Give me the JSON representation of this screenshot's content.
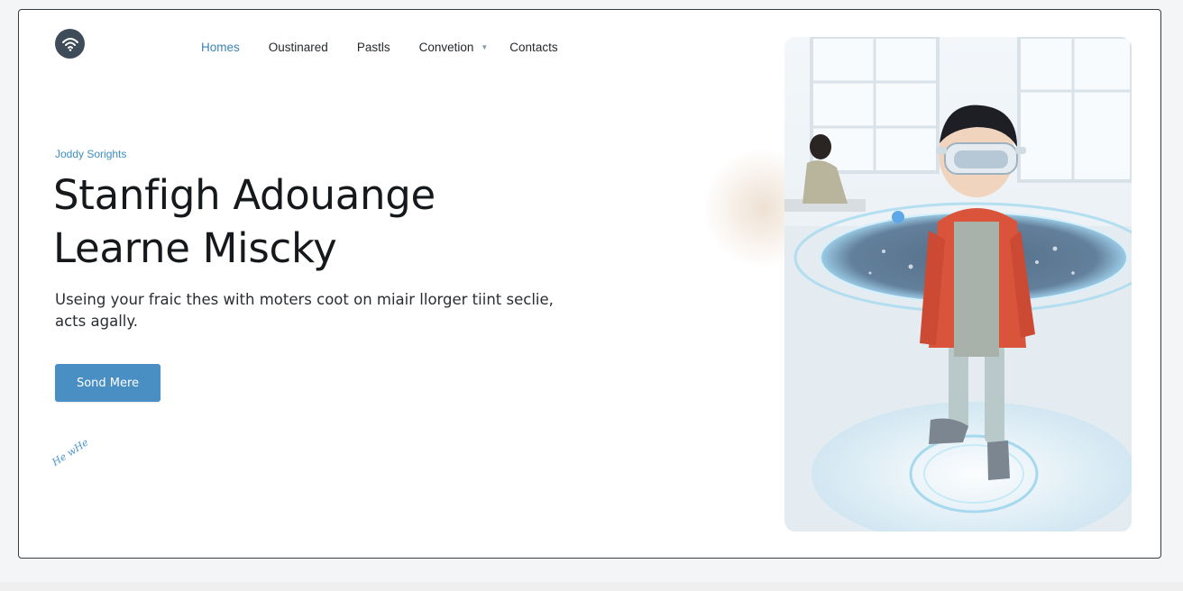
{
  "brand": {
    "logo_icon": "wifi-icon",
    "logo_color": "#3e4c5a"
  },
  "nav": {
    "items": [
      {
        "label": "Homes",
        "active": true
      },
      {
        "label": "Oustinared",
        "active": false
      },
      {
        "label": "Pastls",
        "active": false
      },
      {
        "label": "Convetion",
        "active": false,
        "has_dropdown": true
      },
      {
        "label": "Contacts",
        "active": false
      }
    ],
    "active_color": "#3a85b8"
  },
  "hero": {
    "eyebrow": "Joddy Sorights",
    "headline_line1": "Stanfigh Adouange",
    "headline_line2": "Learne Miscky",
    "subtext_line1": "Useing your fraic thes with moters coot on miair llorger tiint seclie,",
    "subtext_line2": "acts agally.",
    "cta_label": "Sond Mere",
    "cta_color": "#4a8fc4",
    "handwritten_note": "He wHe",
    "image_subject": "child wearing VR goggles standing on holographic map platform"
  }
}
